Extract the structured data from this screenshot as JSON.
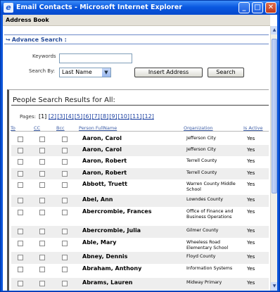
{
  "window": {
    "title": "Email Contacts - Microsoft Internet Explorer"
  },
  "header": {
    "address_book": "Address Book"
  },
  "advance_search": {
    "title": "Advance Search :",
    "keywords_label": "Keywords",
    "keywords_value": "",
    "search_by_label": "Search By:",
    "search_by_value": "Last Name",
    "insert_address": "Insert Address",
    "search": "Search"
  },
  "results": {
    "title": "People Search Results for All:",
    "pages_label": "Pages:",
    "current_page": "[1]",
    "pages": [
      "[2]",
      "[3]",
      "[4]",
      "[5]",
      "[6]",
      "[7]",
      "[8]",
      "[9]",
      "[10]",
      "[11]",
      "[12]"
    ],
    "columns": {
      "to": "To",
      "cc": "CC",
      "bcc": "Bcc",
      "name": "Person FullName",
      "org": "Organization",
      "active": "Is Active"
    },
    "rows": [
      {
        "name": "Aaron, Carol",
        "org": "Jefferson City",
        "active": "Yes"
      },
      {
        "name": "Aaron, Carol",
        "org": "Jefferson City",
        "active": "Yes"
      },
      {
        "name": "Aaron, Robert",
        "org": "Terrell County",
        "active": "Yes"
      },
      {
        "name": "Aaron, Robert",
        "org": "Terrell County",
        "active": "Yes"
      },
      {
        "name": "Abbott, Truett",
        "org": "Warren County Middle School",
        "active": "Yes"
      },
      {
        "name": "Abel, Ann",
        "org": "Lowndes County",
        "active": "Yes"
      },
      {
        "name": "Abercrombie, Frances",
        "org": "Office of Finance and Business Operations",
        "active": "Yes"
      },
      {
        "name": "Abercrombie, Julia",
        "org": "Gilmer County",
        "active": "Yes"
      },
      {
        "name": "Able, Mary",
        "org": "Wheeless Road Elementary School",
        "active": "Yes"
      },
      {
        "name": "Abney, Dennis",
        "org": "Floyd County",
        "active": "Yes"
      },
      {
        "name": "Abraham, Anthony",
        "org": "Information Systems",
        "active": "Yes"
      },
      {
        "name": "Abrams, Lauren",
        "org": "Midway Primary",
        "active": "Yes"
      }
    ]
  }
}
